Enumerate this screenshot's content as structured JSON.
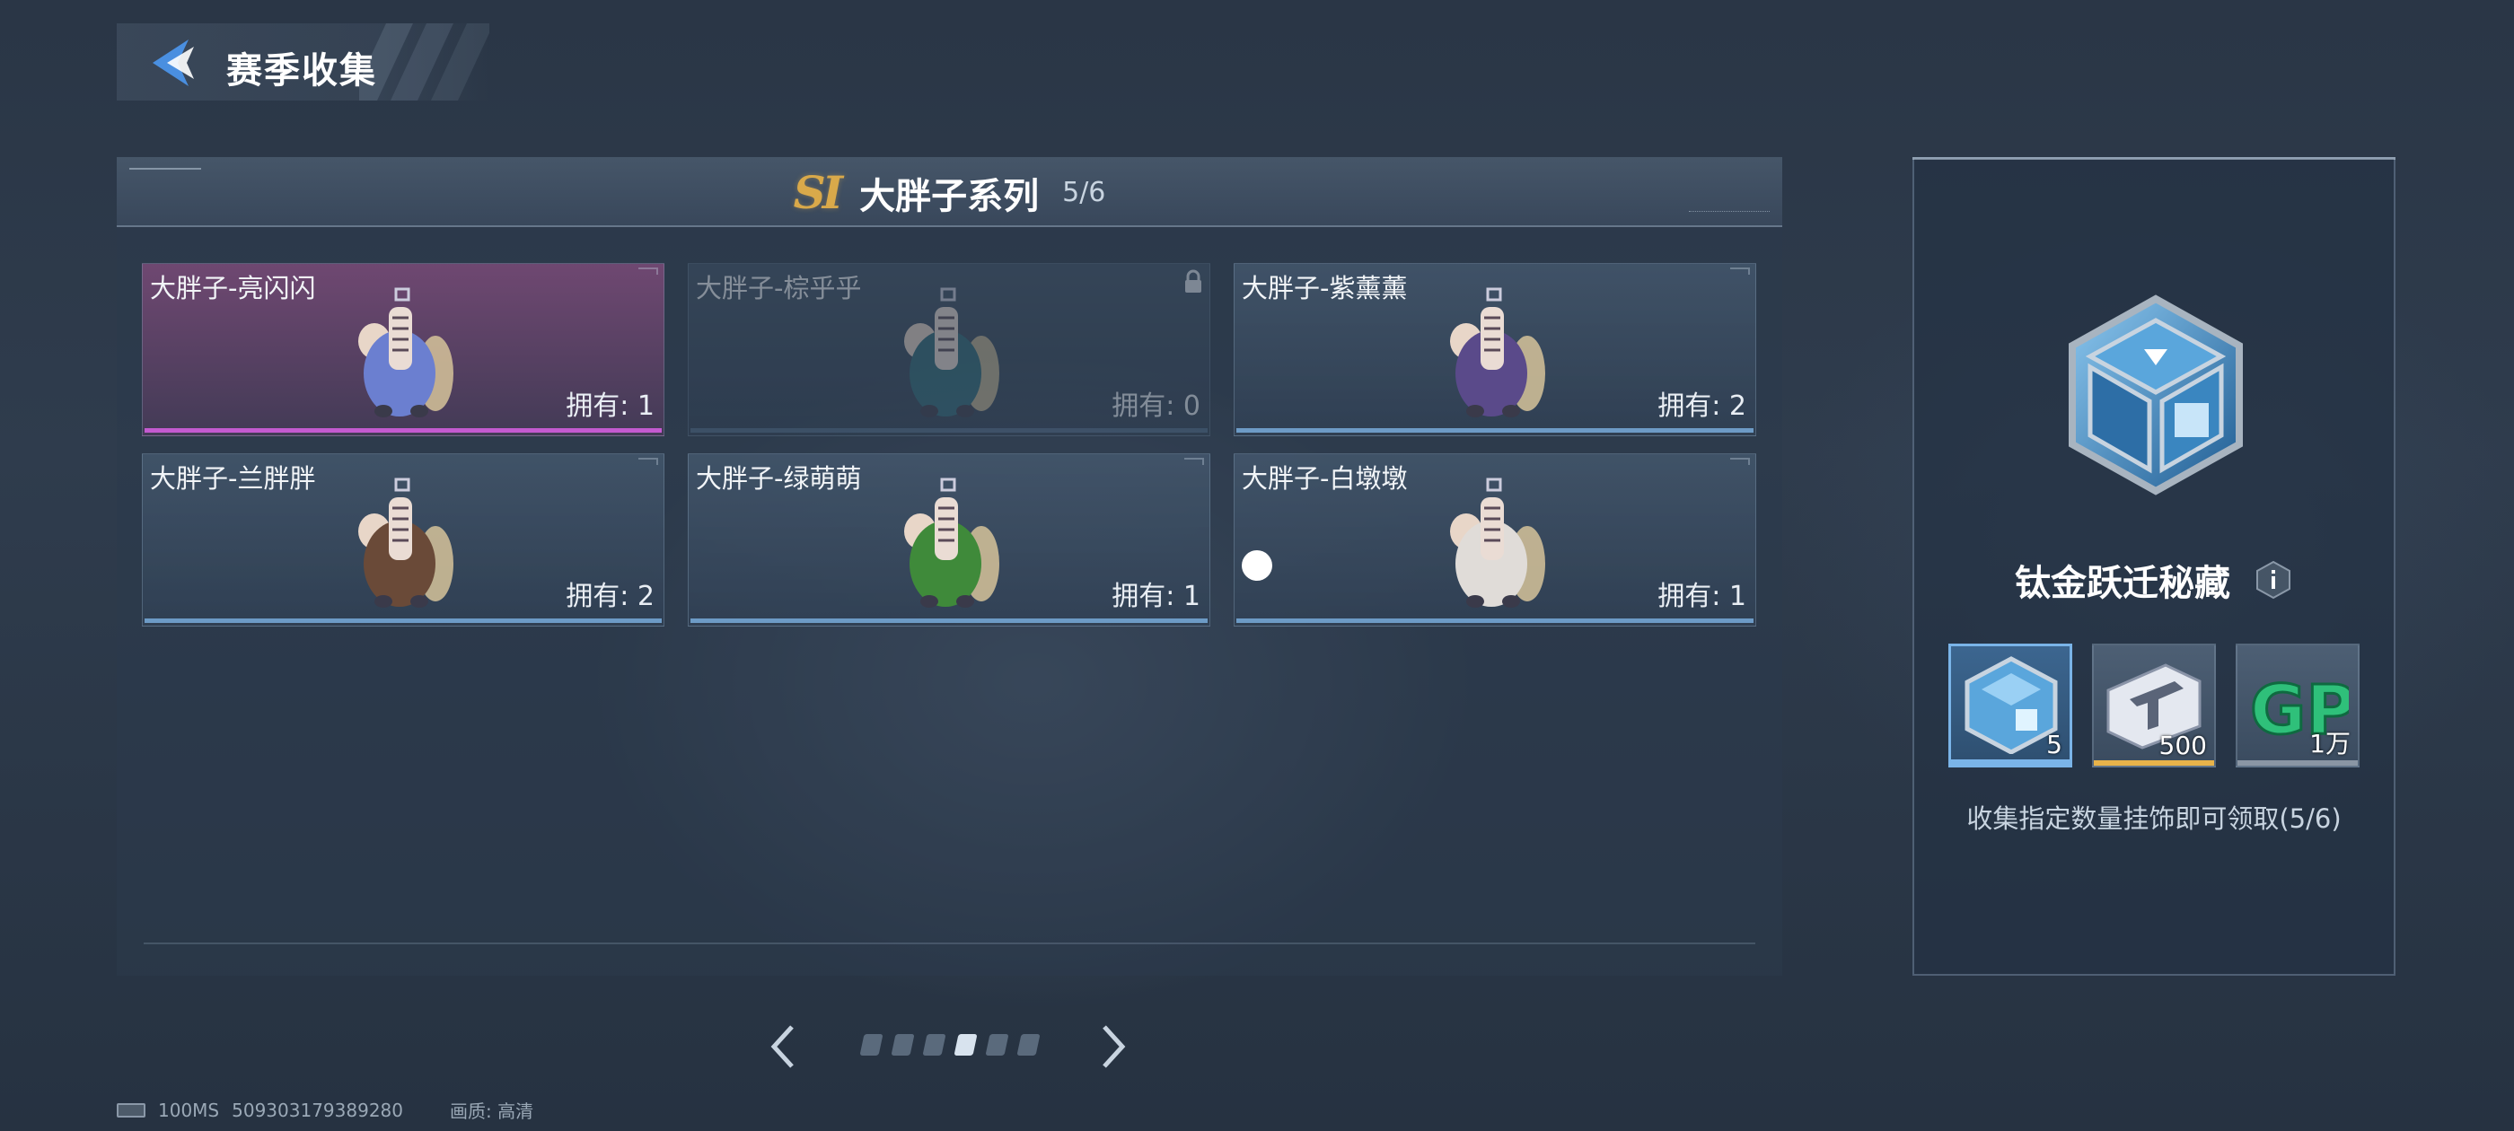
{
  "header": {
    "title": "赛季收集",
    "back_icon": "back-arrow-icon"
  },
  "series": {
    "badge": "SI",
    "title": "大胖子系列",
    "count": "5/6",
    "badge_color": "#d9a94a"
  },
  "cards": [
    {
      "name": "大胖子-亮闪闪",
      "owned": "拥有: 1",
      "rarity": "purple",
      "locked": false,
      "accent": "#c45ad0",
      "body_color": "#6b7fd0"
    },
    {
      "name": "大胖子-棕乎乎",
      "owned": "拥有: 0",
      "rarity": "blue",
      "locked": true,
      "accent": "#4f6a86",
      "body_color": "#2f6a78"
    },
    {
      "name": "大胖子-紫薰薰",
      "owned": "拥有: 2",
      "rarity": "blue",
      "locked": false,
      "accent": "#6d9bc6",
      "body_color": "#5a4a8a"
    },
    {
      "name": "大胖子-兰胖胖",
      "owned": "拥有: 2",
      "rarity": "blue",
      "locked": false,
      "accent": "#6d9bc6",
      "body_color": "#6a4a38"
    },
    {
      "name": "大胖子-绿萌萌",
      "owned": "拥有: 1",
      "rarity": "blue",
      "locked": false,
      "accent": "#6d9bc6",
      "body_color": "#3f8a3a"
    },
    {
      "name": "大胖子-白墩墩",
      "owned": "拥有: 1",
      "rarity": "blue",
      "locked": false,
      "accent": "#6d9bc6",
      "body_color": "#e0dcd8"
    }
  ],
  "pager": {
    "prev_icon": "chevron-left-icon",
    "next_icon": "chevron-right-icon",
    "total_pages": 6,
    "current_page": 4
  },
  "reward": {
    "title": "钛金跃迁秘藏",
    "info_icon": "info-icon",
    "items": [
      {
        "name": "titanium-crate",
        "qty": "5",
        "selected": true,
        "bar_color": "#7ab4e8"
      },
      {
        "name": "ticket",
        "qty": "500",
        "selected": false,
        "bar_color": "#e8b34a"
      },
      {
        "name": "gp-currency",
        "qty": "1万",
        "selected": false,
        "bar_color": "#8a96a4"
      }
    ],
    "hint": "收集指定数量挂饰即可领取(5/6)"
  },
  "footer": {
    "ping": "100MS",
    "uid": "509303179389280",
    "quality": "画质: 高清"
  }
}
